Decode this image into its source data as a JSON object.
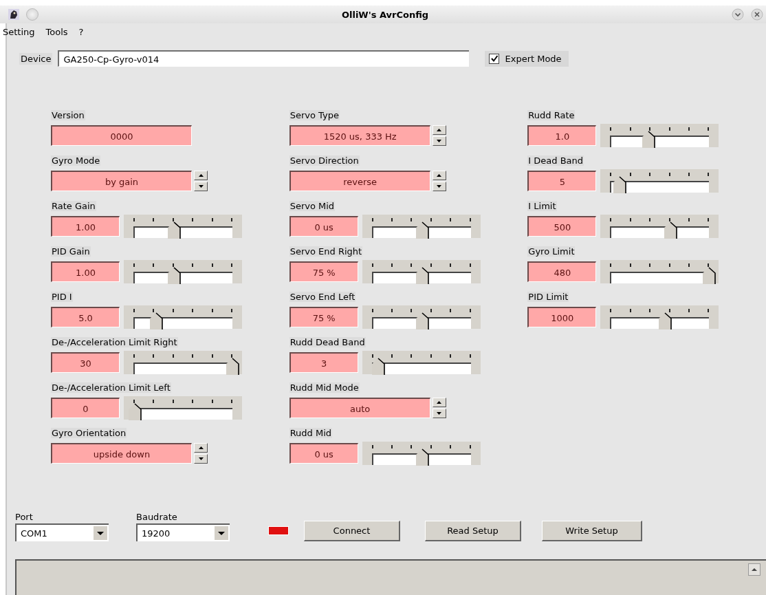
{
  "window": {
    "title": "OlliW's AvrConfig"
  },
  "menu": [
    "Setting",
    "Tools",
    "?"
  ],
  "device": {
    "label": "Device",
    "value": "GA250-Cp-Gyro-v014"
  },
  "expert_mode": {
    "label": "Expert Mode",
    "checked": true
  },
  "columns": [
    [
      {
        "kind": "text",
        "label": "Version",
        "value": "0000"
      },
      {
        "kind": "spin",
        "label": "Gyro Mode",
        "value": "by gain"
      },
      {
        "kind": "slider",
        "label": "Rate Gain",
        "value": "1.00",
        "level": 0.4
      },
      {
        "kind": "slider",
        "label": "PID Gain",
        "value": "1.00",
        "level": 0.4
      },
      {
        "kind": "slider",
        "label": "PID I",
        "value": "5.0",
        "level": 0.22
      },
      {
        "kind": "slider",
        "label": "De-/Acceleration Limit Right",
        "value": "30",
        "level": 1.0
      },
      {
        "kind": "slider",
        "label": "De-/Acceleration Limit Left",
        "value": "0",
        "level": 0.0
      },
      {
        "kind": "spin",
        "label": "Gyro Orientation",
        "value": "upside down"
      }
    ],
    [
      {
        "kind": "spin",
        "label": "Servo Type",
        "value": "1520 us, 333 Hz"
      },
      {
        "kind": "spin",
        "label": "Servo Direction",
        "value": "reverse"
      },
      {
        "kind": "slider",
        "label": "Servo Mid",
        "value": "0 us",
        "level": 0.5
      },
      {
        "kind": "slider",
        "label": "Servo End Right",
        "value": "75 %",
        "level": 0.5
      },
      {
        "kind": "slider",
        "label": "Servo End Left",
        "value": "75 %",
        "level": 0.5
      },
      {
        "kind": "slider",
        "label": "Rudd Dead Band",
        "value": "3",
        "level": 0.05
      },
      {
        "kind": "spin",
        "label": "Rudd Mid Mode",
        "value": "auto"
      },
      {
        "kind": "slider",
        "label": "Rudd Mid",
        "value": "0 us",
        "level": 0.5
      }
    ],
    [
      {
        "kind": "slider",
        "label": "Rudd Rate",
        "value": "1.0",
        "level": 0.38
      },
      {
        "kind": "slider",
        "label": "I Dead Band",
        "value": "5",
        "level": 0.08
      },
      {
        "kind": "slider",
        "label": "I Limit",
        "value": "500",
        "level": 0.6
      },
      {
        "kind": "slider",
        "label": "Gyro Limit",
        "value": "480",
        "level": 1.0
      },
      {
        "kind": "slider",
        "label": "PID Limit",
        "value": "1000",
        "level": 0.55
      }
    ]
  ],
  "port": {
    "label": "Port",
    "value": "COM1"
  },
  "baudrate": {
    "label": "Baudrate",
    "value": "19200"
  },
  "connected": false,
  "buttons": [
    "Connect",
    "Read Setup",
    "Write Setup"
  ]
}
